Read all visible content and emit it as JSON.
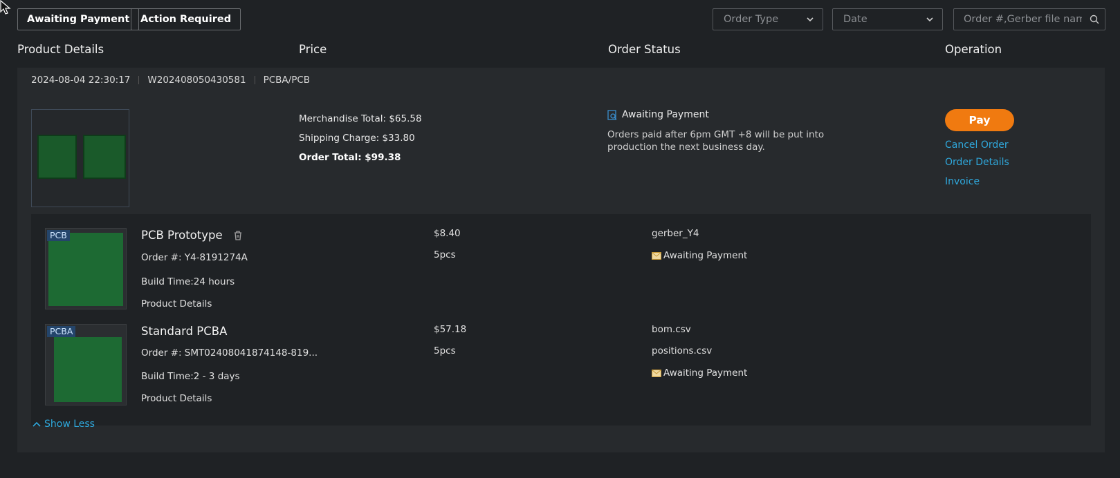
{
  "filters": {
    "awaiting_payment": "Awaiting Payment",
    "action_required": "Action Required",
    "order_type_placeholder": "Order Type",
    "date_placeholder": "Date",
    "search_placeholder": "Order #,Gerber file name."
  },
  "columns": {
    "product_details": "Product Details",
    "price": "Price",
    "order_status": "Order Status",
    "operation": "Operation"
  },
  "order": {
    "datetime": "2024-08-04 22:30:17",
    "order_no": "W202408050430581",
    "type": "PCBA/PCB",
    "merchandise_total": "Merchandise Total: $65.58",
    "shipping_charge": "Shipping Charge: $33.80",
    "order_total": "Order Total: $99.38",
    "status": "Awaiting Payment",
    "status_note": "Orders paid after 6pm GMT +8 will be put into production the next business day.",
    "ops": {
      "pay": "Pay",
      "cancel": "Cancel Order",
      "details": "Order Details",
      "invoice": "Invoice"
    },
    "items": [
      {
        "tag": "PCB",
        "title": "PCB Prototype",
        "order_no": "Order #: Y4-8191274A",
        "build_time": "Build Time:24 hours",
        "link": "Product Details",
        "price": "$8.40",
        "qty": "5pcs",
        "files": [
          "gerber_Y4"
        ],
        "status": "Awaiting Payment"
      },
      {
        "tag": "PCBA",
        "title": "Standard PCBA",
        "order_no": "Order #: SMT02408041874148-819...",
        "build_time": "Build Time:2 - 3 days",
        "link": "Product Details",
        "price": "$57.18",
        "qty": "5pcs",
        "files": [
          "bom.csv",
          "positions.csv"
        ],
        "status": "Awaiting Payment"
      }
    ],
    "show_less": "Show Less"
  },
  "colors": {
    "accent_link": "#2fa8dc",
    "pay_button": "#f07a10",
    "background": "#1f2225",
    "card": "#272a2d"
  }
}
